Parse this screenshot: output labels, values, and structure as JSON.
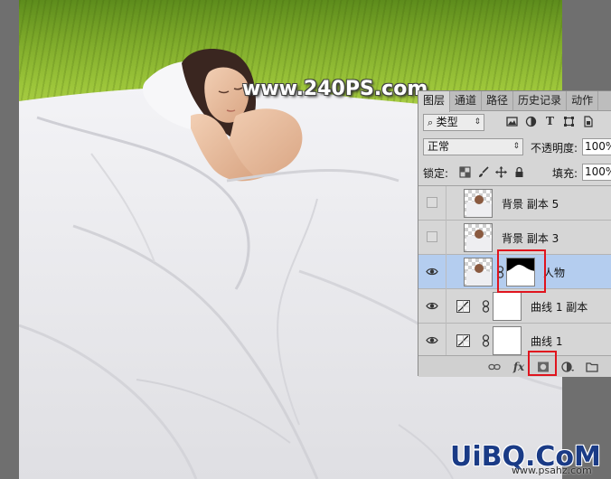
{
  "watermark": "www.240PS.com",
  "site_logo": "UiBQ.CoM",
  "site_url": "www.psahz.com",
  "panel": {
    "tabs": [
      "图层",
      "通道",
      "路径",
      "历史记录",
      "动作"
    ],
    "filter_kind": "类型",
    "filter_icons": [
      "image-icon",
      "adjust-icon",
      "type-icon",
      "shape-icon",
      "smart-object-icon"
    ],
    "blend_mode": "正常",
    "opacity_label": "不透明度:",
    "opacity_value": "100%",
    "lock_label": "锁定:",
    "fill_label": "填充:",
    "fill_value": "100%",
    "layers": [
      {
        "name": "背景 副本 5",
        "visible": false,
        "selected": false,
        "kind": "pixel"
      },
      {
        "name": "背景 副本 3",
        "visible": false,
        "selected": false,
        "kind": "pixel"
      },
      {
        "name": "人物",
        "visible": true,
        "selected": true,
        "kind": "pixel-mask"
      },
      {
        "name": "曲线 1 副本",
        "visible": true,
        "selected": false,
        "kind": "curves"
      },
      {
        "name": "曲线 1",
        "visible": true,
        "selected": false,
        "kind": "curves"
      }
    ],
    "footer_icons": [
      "link-icon",
      "fx-icon",
      "add-mask-icon",
      "adjustment-icon",
      "folder-icon"
    ]
  },
  "colors": {
    "selected_row": "#b4cdef",
    "highlight": "#e0141e",
    "logo": "#1a3b86"
  }
}
